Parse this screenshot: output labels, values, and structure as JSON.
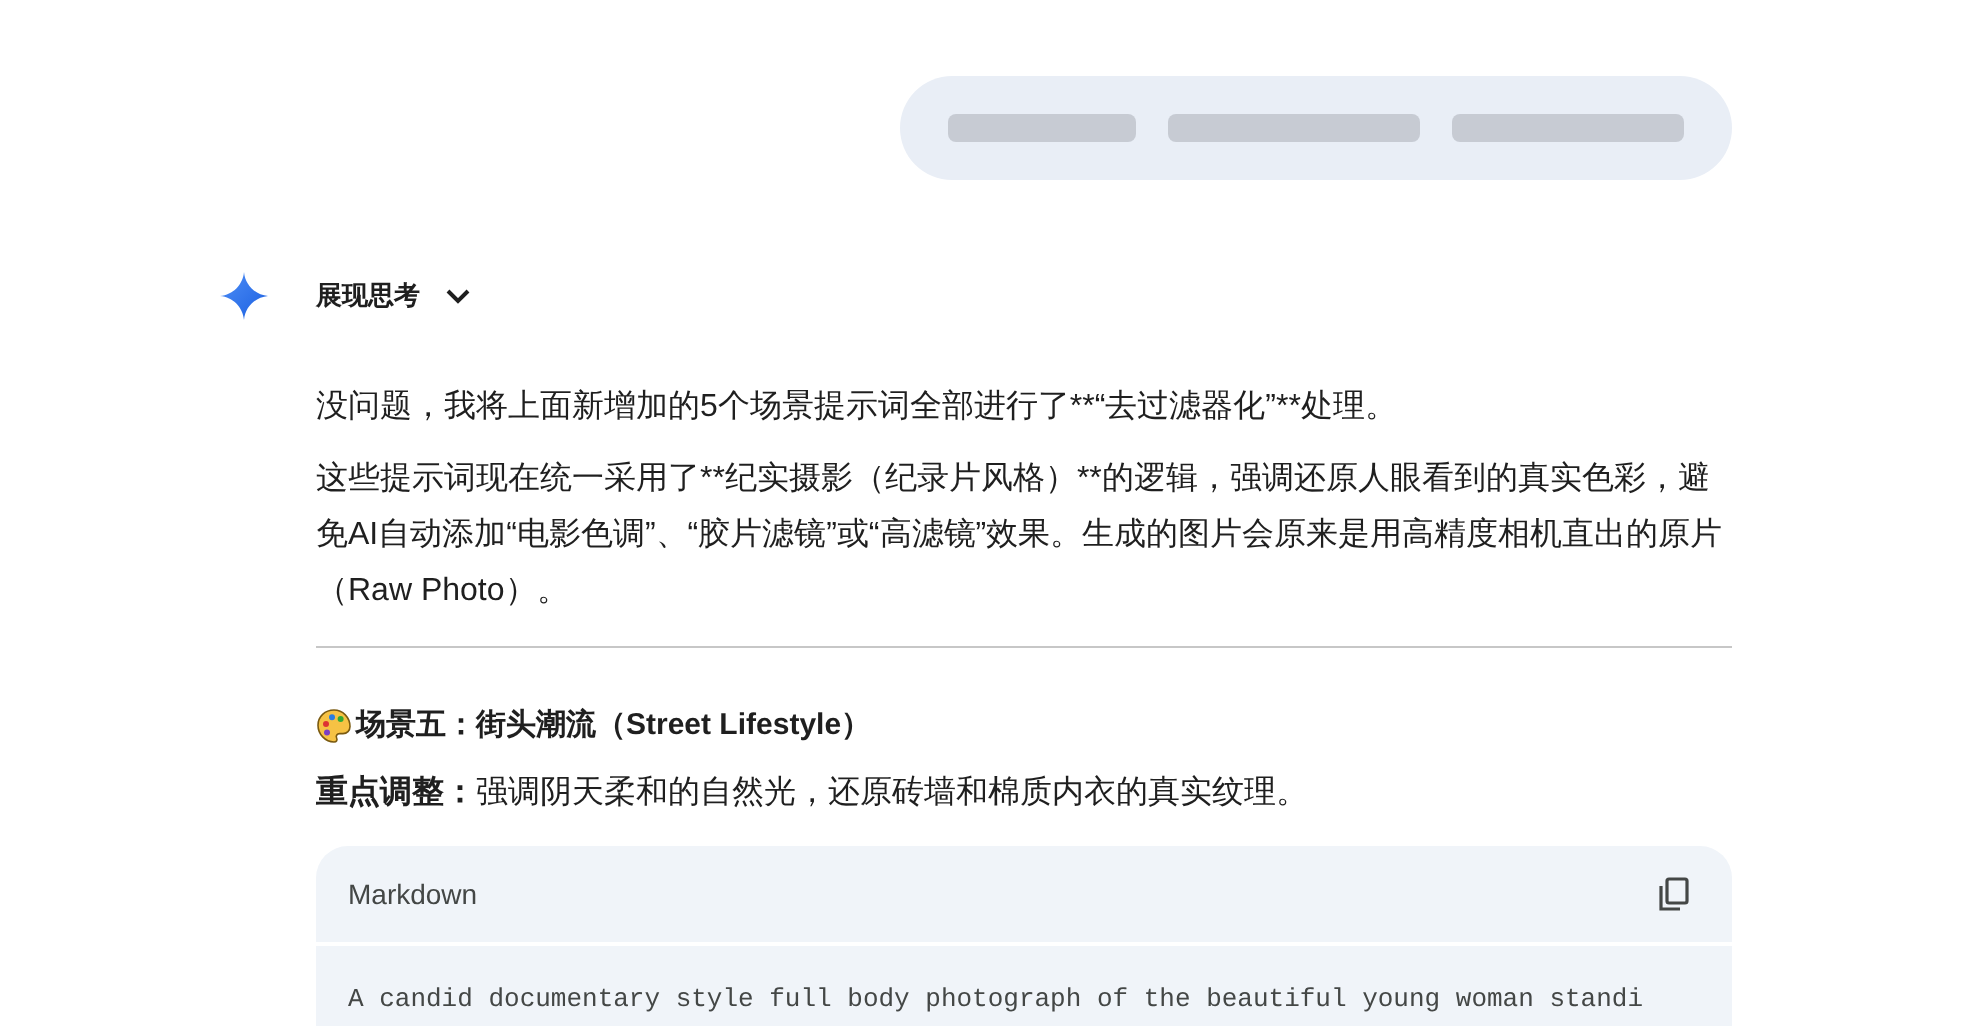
{
  "response": {
    "thinking_toggle": {
      "label": "展现思考",
      "expanded": false
    },
    "paragraphs": [
      "没问题，我将上面新增加的5个场景提示词全部进行了**“去过滤器化”**处理。",
      "这些提示词现在统一采用了**纪实摄影（纪录片风格）**的逻辑，强调还原人眼看到的真实色彩，避免AI自动添加“电影色调”、“胶片滤镜”或“高滤镜”效果。生成的图片会原来是用高精度相机直出的原片（Raw Photo）。"
    ],
    "section": {
      "heading": "场景五：街头潮流（Street Lifestyle）",
      "note": "**重点调整：**强调阴天柔和的自然光，还原砖墙和棉质内衣的真实纹理。"
    },
    "code_block": {
      "language": "Markdown",
      "code": "A candid documentary style full body photograph of the beautiful young woman standi"
    }
  }
}
